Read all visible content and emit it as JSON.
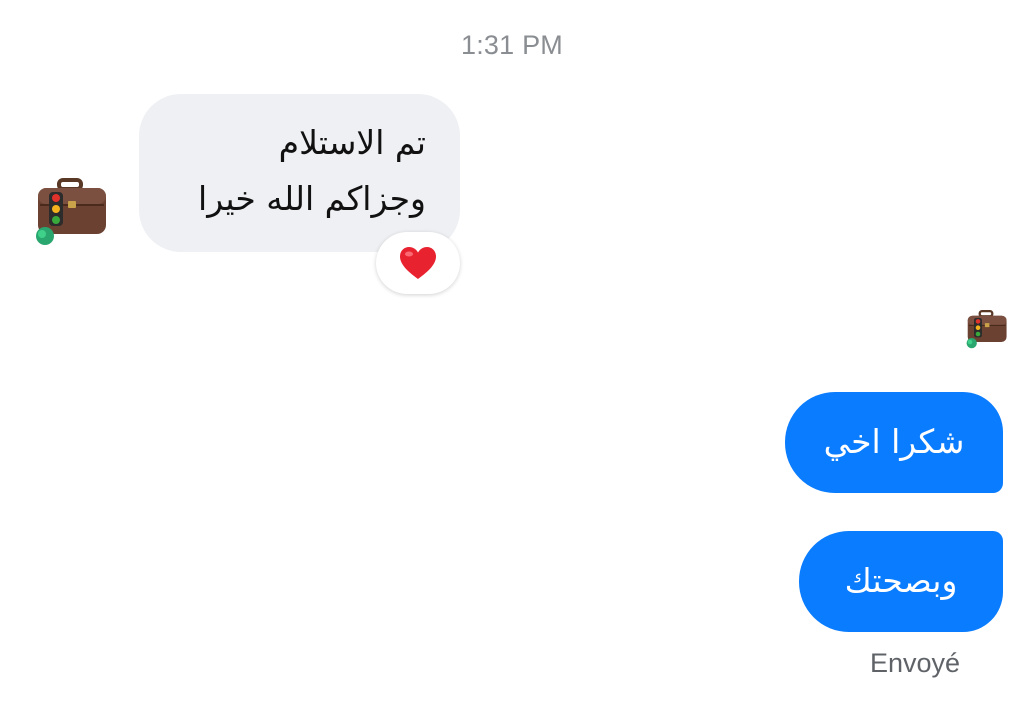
{
  "timestamp": "1:31 PM",
  "incoming": {
    "lines": [
      "تم الاستلام",
      "وجزاكم الله خيرا"
    ],
    "reaction": "heart-emoji"
  },
  "outgoing": [
    {
      "text": "شكرا اخي"
    },
    {
      "text": "وبصحتك"
    }
  ],
  "status": "Envoyé",
  "colors": {
    "incoming_bubble": "#eef0f3",
    "outgoing_bubble": "#0a7cff",
    "heart": "#e8232f"
  },
  "icons": {
    "avatar": "briefcase-traffic-light-avatar",
    "read_receipt": "briefcase-traffic-light-avatar"
  }
}
